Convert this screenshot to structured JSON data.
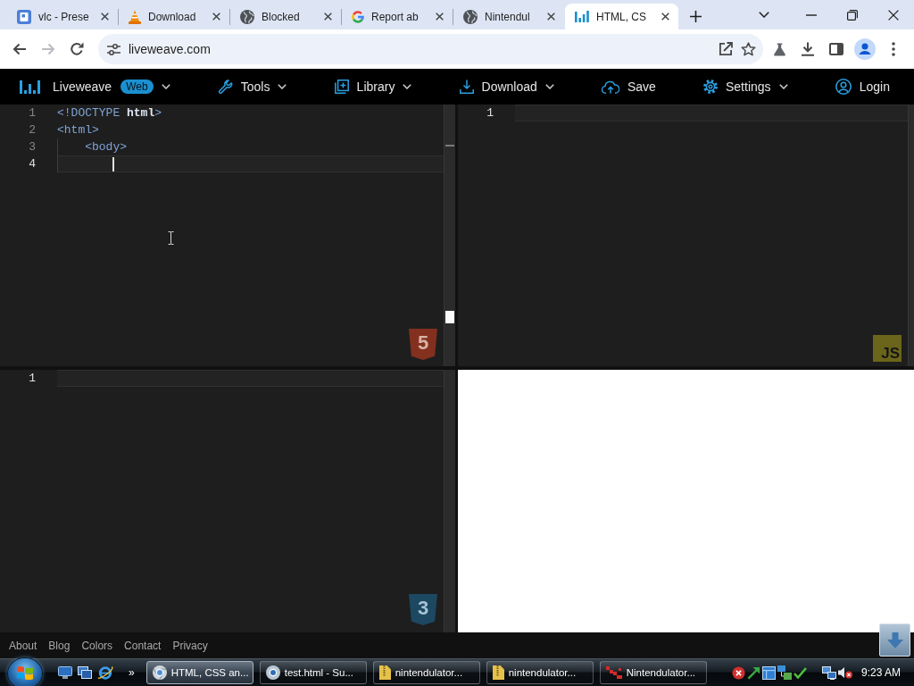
{
  "browser": {
    "tabs": [
      {
        "title": "vlc - Prese",
        "selected": false
      },
      {
        "title": "Download",
        "selected": false
      },
      {
        "title": "Blocked",
        "selected": false
      },
      {
        "title": "Report ab",
        "selected": false
      },
      {
        "title": "Nintendul",
        "selected": false
      },
      {
        "title": "HTML, CS",
        "selected": true
      }
    ],
    "nav_buttons": [
      {
        "kind": "back",
        "disabled": false
      },
      {
        "kind": "forward",
        "disabled": true
      },
      {
        "kind": "reload",
        "disabled": false
      }
    ],
    "address": "liveweave.com"
  },
  "liveweave": {
    "brand": {
      "name": "Liveweave",
      "badge": "Web",
      "dropdown": true
    },
    "menus": [
      {
        "label": "Tools",
        "dropdown": true
      },
      {
        "label": "Library",
        "dropdown": true
      },
      {
        "label": "Download",
        "dropdown": true
      },
      {
        "label": "Save",
        "dropdown": false
      },
      {
        "label": "Settings",
        "dropdown": true
      },
      {
        "label": "Login",
        "dropdown": false
      }
    ]
  },
  "editors": [
    {
      "kind": "html",
      "badge": "5",
      "lines": [
        {
          "number": "1",
          "text": "<!DOCTYPE **html**>",
          "active": false,
          "cursor": false
        },
        {
          "number": "2",
          "text": "<html>",
          "active": false,
          "cursor": false,
          "children": [
            {
              "number": "3",
              "text": "<body>",
              "active": false,
              "cursor": false,
              "children": [
                {
                  "number": "4",
                  "active": true,
                  "cursor": true
                }
              ]
            }
          ]
        }
      ]
    },
    {
      "kind": "js",
      "badge": "JS",
      "lines": [
        {
          "number": "1",
          "active": true,
          "cursor": false
        }
      ]
    },
    {
      "kind": "css",
      "badge": "3",
      "lines": [
        {
          "number": "1",
          "active": true,
          "cursor": false
        }
      ]
    }
  ],
  "footer": {
    "links": [
      "About",
      "Blog",
      "Colors",
      "Contact",
      "Privacy"
    ]
  },
  "taskbar": {
    "more": "»",
    "tasks": [
      {
        "label": "HTML, CSS an...",
        "selected": true
      },
      {
        "label": "test.html - Su...",
        "selected": false
      },
      {
        "label": "nintendulator...",
        "selected": false
      },
      {
        "label": "nintendulator...",
        "selected": false
      },
      {
        "label": "Nintendulator...",
        "selected": false
      }
    ],
    "clock": "9:23 AM"
  }
}
